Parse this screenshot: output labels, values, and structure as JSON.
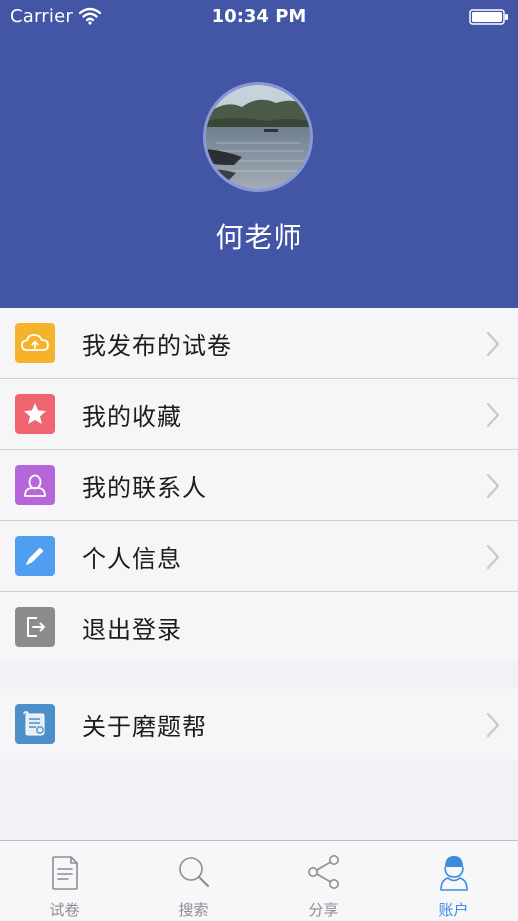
{
  "status_bar": {
    "carrier": "Carrier",
    "time": "10:34 PM"
  },
  "profile": {
    "name": "何老师"
  },
  "menu": {
    "group1": [
      {
        "label": "我发布的试卷",
        "icon": "cloud-upload-icon",
        "color": "#f5b22b"
      },
      {
        "label": "我的收藏",
        "icon": "star-icon",
        "color": "#ef6570"
      },
      {
        "label": "我的联系人",
        "icon": "contact-person-icon",
        "color": "#b566d8"
      },
      {
        "label": "个人信息",
        "icon": "pencil-icon",
        "color": "#4f9ef0"
      },
      {
        "label": "退出登录",
        "icon": "logout-icon",
        "color": "#8c8c8c"
      }
    ],
    "group2": [
      {
        "label": "关于磨题帮",
        "icon": "scroll-icon",
        "color": "#4d8fc9"
      }
    ]
  },
  "tab_bar": {
    "tabs": [
      {
        "label": "试卷",
        "icon": "document-icon"
      },
      {
        "label": "搜索",
        "icon": "search-icon"
      },
      {
        "label": "分享",
        "icon": "share-icon"
      },
      {
        "label": "账户",
        "icon": "user-account-icon"
      }
    ],
    "active_tab": "账户",
    "active_color": "#3d8be0",
    "inactive_color": "#8e8e93"
  },
  "theme": {
    "header_color": "#4356a6"
  }
}
